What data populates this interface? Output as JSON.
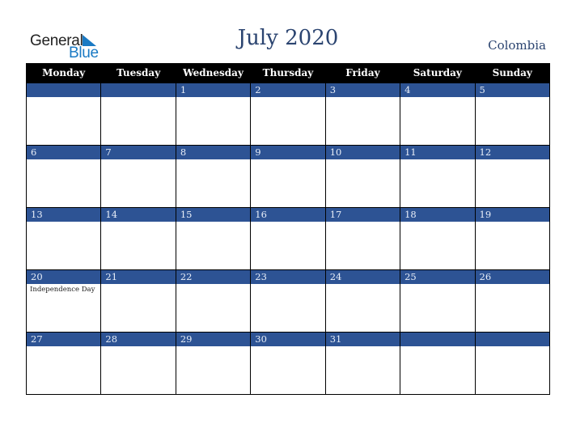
{
  "logo": {
    "word1": "General",
    "word2": "Blue"
  },
  "title": "July 2020",
  "country": "Colombia",
  "weekdays": [
    "Monday",
    "Tuesday",
    "Wednesday",
    "Thursday",
    "Friday",
    "Saturday",
    "Sunday"
  ],
  "weeks": [
    [
      {
        "day": "",
        "event": ""
      },
      {
        "day": "",
        "event": ""
      },
      {
        "day": "1",
        "event": ""
      },
      {
        "day": "2",
        "event": ""
      },
      {
        "day": "3",
        "event": ""
      },
      {
        "day": "4",
        "event": ""
      },
      {
        "day": "5",
        "event": ""
      }
    ],
    [
      {
        "day": "6",
        "event": ""
      },
      {
        "day": "7",
        "event": ""
      },
      {
        "day": "8",
        "event": ""
      },
      {
        "day": "9",
        "event": ""
      },
      {
        "day": "10",
        "event": ""
      },
      {
        "day": "11",
        "event": ""
      },
      {
        "day": "12",
        "event": ""
      }
    ],
    [
      {
        "day": "13",
        "event": ""
      },
      {
        "day": "14",
        "event": ""
      },
      {
        "day": "15",
        "event": ""
      },
      {
        "day": "16",
        "event": ""
      },
      {
        "day": "17",
        "event": ""
      },
      {
        "day": "18",
        "event": ""
      },
      {
        "day": "19",
        "event": ""
      }
    ],
    [
      {
        "day": "20",
        "event": "Independence Day"
      },
      {
        "day": "21",
        "event": ""
      },
      {
        "day": "22",
        "event": ""
      },
      {
        "day": "23",
        "event": ""
      },
      {
        "day": "24",
        "event": ""
      },
      {
        "day": "25",
        "event": ""
      },
      {
        "day": "26",
        "event": ""
      }
    ],
    [
      {
        "day": "27",
        "event": ""
      },
      {
        "day": "28",
        "event": ""
      },
      {
        "day": "29",
        "event": ""
      },
      {
        "day": "30",
        "event": ""
      },
      {
        "day": "31",
        "event": ""
      },
      {
        "day": "",
        "event": ""
      },
      {
        "day": "",
        "event": ""
      }
    ]
  ],
  "colors": {
    "header_bg": "#000000",
    "day_bar": "#2d5394",
    "title": "#2b4470",
    "brand_blue": "#1a7ac4"
  }
}
